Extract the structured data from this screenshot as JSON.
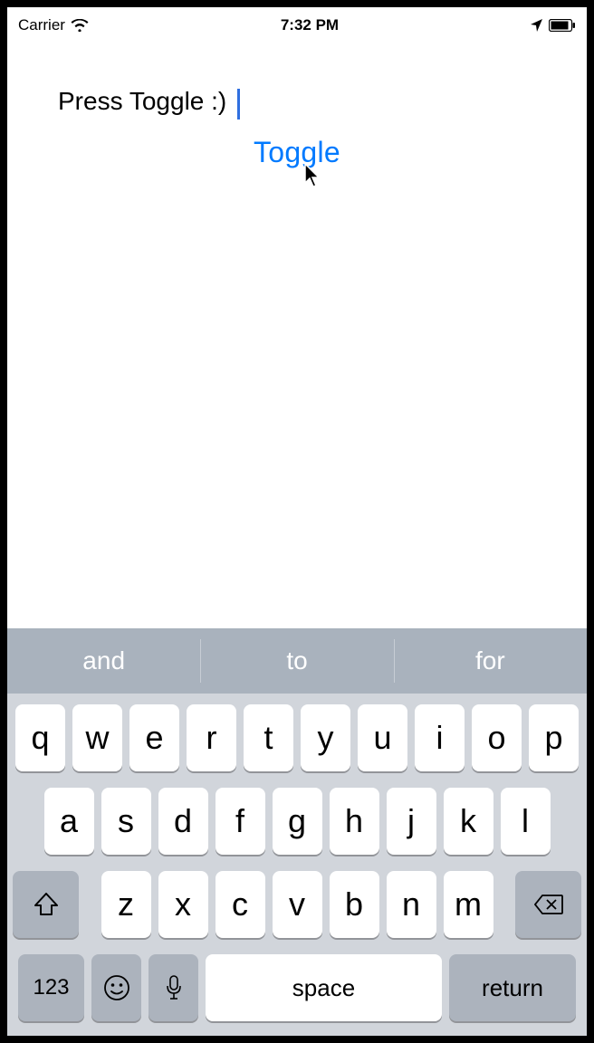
{
  "statusBar": {
    "carrier": "Carrier",
    "time": "7:32 PM"
  },
  "content": {
    "textValue": "Press Toggle :)",
    "toggleLabel": "Toggle"
  },
  "keyboard": {
    "suggestions": [
      "and",
      "to",
      "for"
    ],
    "row1": [
      "q",
      "w",
      "e",
      "r",
      "t",
      "y",
      "u",
      "i",
      "o",
      "p"
    ],
    "row2": [
      "a",
      "s",
      "d",
      "f",
      "g",
      "h",
      "j",
      "k",
      "l"
    ],
    "row3": [
      "z",
      "x",
      "c",
      "v",
      "b",
      "n",
      "m"
    ],
    "numKey": "123",
    "spaceLabel": "space",
    "returnLabel": "return"
  }
}
